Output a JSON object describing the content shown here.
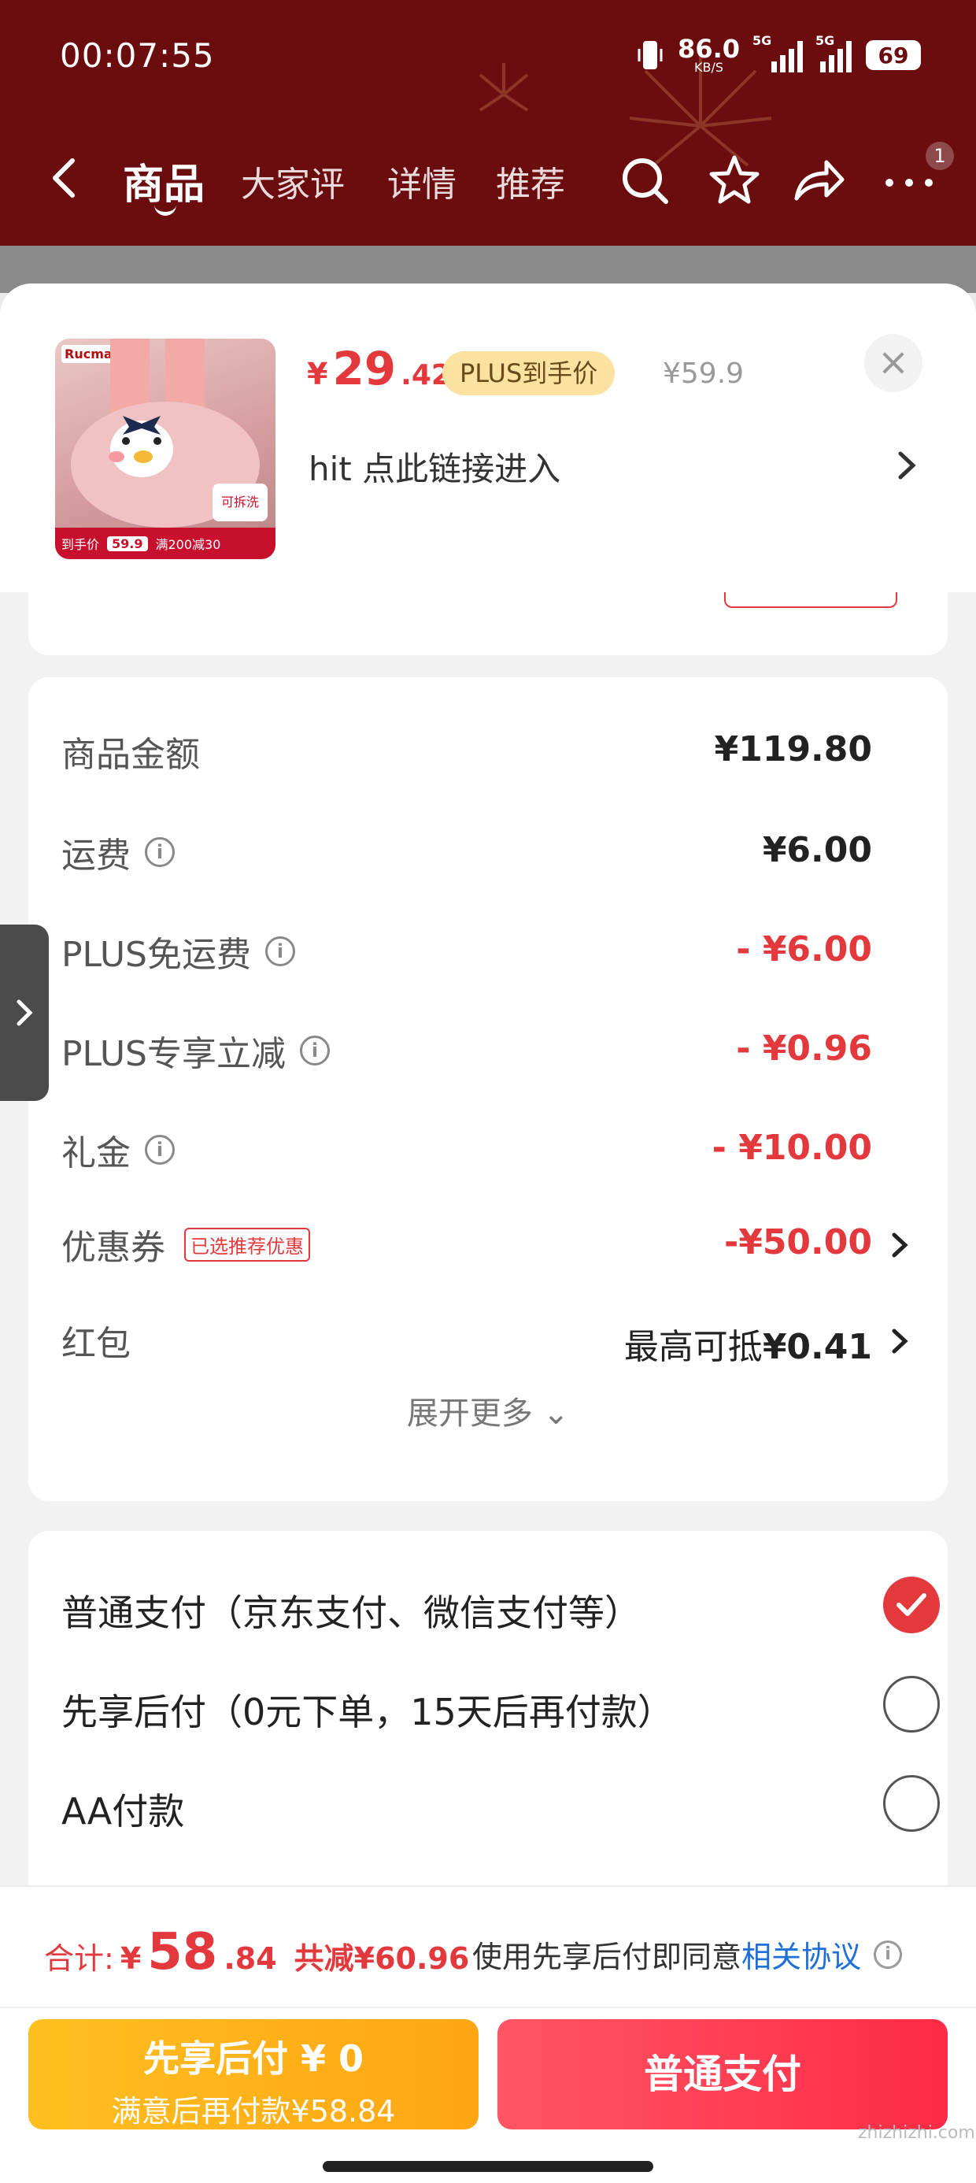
{
  "status": {
    "time": "00:07:55",
    "speed_value": "86.0",
    "speed_unit": "KB/S",
    "net1": "5G",
    "net2": "5G",
    "battery": "69"
  },
  "nav": {
    "tabs": [
      "商品",
      "大家评",
      "详情",
      "推荐"
    ],
    "badge": "1",
    "icons": [
      "back-arrow-icon",
      "search-icon",
      "star-icon",
      "share-icon",
      "more-icon"
    ]
  },
  "product": {
    "currency": "¥",
    "price_int": "29",
    "price_dec": ".42",
    "plus_tag": "PLUS到手价",
    "original_price": "¥59.9",
    "close": "×",
    "link_text": "hit  点此链接进入",
    "thumb": {
      "brand": "Rucma",
      "wash_tag": "可拆洗",
      "strip_label": "到手价",
      "strip_price": "59.9",
      "strip_promo": "满200减30"
    }
  },
  "summary": {
    "rows": [
      {
        "label": "商品金额",
        "value": "¥119.80",
        "info": false
      },
      {
        "label": "运费",
        "value": "¥6.00",
        "info": true
      },
      {
        "label": "PLUS免运费",
        "value": "- ¥6.00",
        "info": true
      },
      {
        "label": "PLUS专享立减",
        "value": "- ¥0.96",
        "info": true
      },
      {
        "label": "礼金",
        "value": "- ¥10.00",
        "info": true
      },
      {
        "label": "优惠券",
        "tag": "已选推荐优惠",
        "value": "-¥50.00"
      },
      {
        "label": "红包",
        "prefix": "最高可抵",
        "value": "¥0.41"
      }
    ],
    "expand_more": "展开更多 ⌄"
  },
  "payment": {
    "options": [
      {
        "label": "普通支付（京东支付、微信支付等）",
        "checked": true
      },
      {
        "label": "先享后付（0元下单，15天后再付款）",
        "checked": false
      },
      {
        "label": "AA付款",
        "checked": false
      }
    ]
  },
  "bottom": {
    "total_label": "合计:",
    "currency": "¥",
    "total_int": "58",
    "total_dec": ".84",
    "saved": "共减¥60.96",
    "agree_text": "使用先享后付即同意",
    "agree_link": "相关协议",
    "bnpl_line1": "先享后付 ¥ 0",
    "bnpl_line2": "满意后再付款¥58.84",
    "pay_button": "普通支付",
    "watermark": "zhizhizhi.com"
  },
  "colors": {
    "header": "#6b0c0e",
    "accent": "#e4393c",
    "plus_tag_bg": "#fbe2a1",
    "bnpl_button": "#ffaf17",
    "pay_button": "#ff3a50",
    "link": "#1e6fd8"
  }
}
